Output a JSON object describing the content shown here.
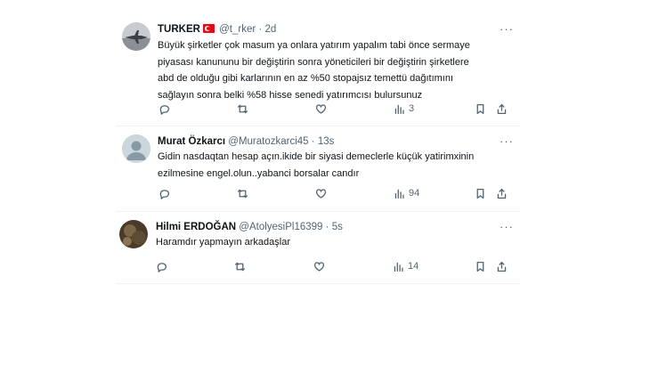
{
  "tweets": [
    {
      "name": "TURKER",
      "handle": "@t_rker",
      "sep": "·",
      "time": "2d",
      "lines": [
        "Büyük şirketler çok masum ya onlara yatırım yapalım tabi önce sermaye",
        "piyasası kanununu bir değiştirin sonra yöneticileri bir değiştirin şirketlere",
        "abd de olduğu gibi karlarının en az %50 stopajsız temettü dağıtımını",
        "sağlayın sonra belki %58 hisse senedi yatırımcısı bulursunuz"
      ],
      "views": "3"
    },
    {
      "name": "Murat Özkarcı",
      "handle": "@Muratozkarci45",
      "sep": "·",
      "time": "13s",
      "lines": [
        "Gidin nasdaqtan hesap açın.ikide bir siyasi demeclerle küçük yatirimxinin",
        "ezilmesine engel.olun..yabanci borsalar candır"
      ],
      "views": "94"
    },
    {
      "name": "Hilmi ERDOĞAN",
      "handle": "@AtolyesiPl16399",
      "sep": "·",
      "time": "5s",
      "lines": [
        "Haramdır yapmayın arkadaşlar"
      ],
      "views": "14"
    }
  ],
  "more_label": "···",
  "icons": [
    "reply-icon",
    "retweet-icon",
    "like-icon",
    "views-icon",
    "bookmark-icon",
    "share-icon"
  ]
}
